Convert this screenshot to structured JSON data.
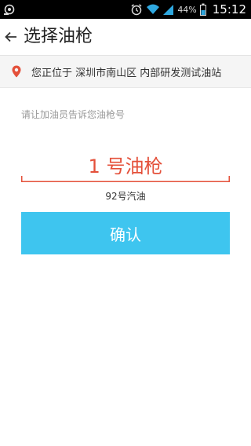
{
  "status_bar": {
    "battery": "44%",
    "time": "15:12"
  },
  "header": {
    "title": "选择油枪"
  },
  "location": {
    "text": "您正位于 深圳市南山区 内部研发测试油站"
  },
  "form": {
    "hint": "请让加油员告诉您油枪号",
    "pump_number": "1 号油枪",
    "fuel_type": "92号汽油",
    "confirm_label": "确认"
  },
  "colors": {
    "accent": "#3ec5ef",
    "pump_text": "#e4503a",
    "pin": "#e4503a"
  },
  "icons": {
    "status_left": "notification-icon",
    "alarm": "alarm-icon",
    "wifi": "wifi-icon",
    "signal": "signal-icon",
    "battery": "battery-icon",
    "back": "back-arrow-icon",
    "pin": "location-pin-icon"
  }
}
